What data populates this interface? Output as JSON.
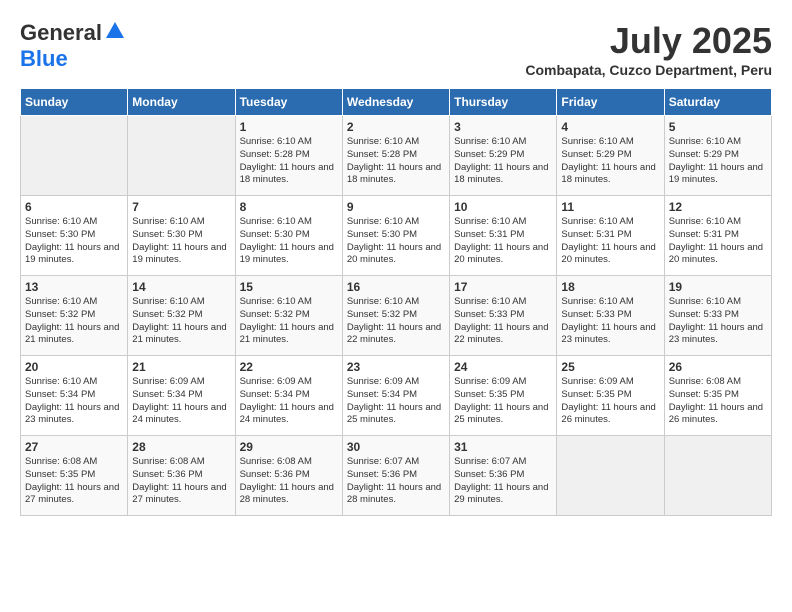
{
  "header": {
    "logo_general": "General",
    "logo_blue": "Blue",
    "month_year": "July 2025",
    "location": "Combapata, Cuzco Department, Peru"
  },
  "days_of_week": [
    "Sunday",
    "Monday",
    "Tuesday",
    "Wednesday",
    "Thursday",
    "Friday",
    "Saturday"
  ],
  "weeks": [
    [
      {
        "day": "",
        "info": ""
      },
      {
        "day": "",
        "info": ""
      },
      {
        "day": "1",
        "info": "Sunrise: 6:10 AM\nSunset: 5:28 PM\nDaylight: 11 hours and 18 minutes."
      },
      {
        "day": "2",
        "info": "Sunrise: 6:10 AM\nSunset: 5:28 PM\nDaylight: 11 hours and 18 minutes."
      },
      {
        "day": "3",
        "info": "Sunrise: 6:10 AM\nSunset: 5:29 PM\nDaylight: 11 hours and 18 minutes."
      },
      {
        "day": "4",
        "info": "Sunrise: 6:10 AM\nSunset: 5:29 PM\nDaylight: 11 hours and 18 minutes."
      },
      {
        "day": "5",
        "info": "Sunrise: 6:10 AM\nSunset: 5:29 PM\nDaylight: 11 hours and 19 minutes."
      }
    ],
    [
      {
        "day": "6",
        "info": "Sunrise: 6:10 AM\nSunset: 5:30 PM\nDaylight: 11 hours and 19 minutes."
      },
      {
        "day": "7",
        "info": "Sunrise: 6:10 AM\nSunset: 5:30 PM\nDaylight: 11 hours and 19 minutes."
      },
      {
        "day": "8",
        "info": "Sunrise: 6:10 AM\nSunset: 5:30 PM\nDaylight: 11 hours and 19 minutes."
      },
      {
        "day": "9",
        "info": "Sunrise: 6:10 AM\nSunset: 5:30 PM\nDaylight: 11 hours and 20 minutes."
      },
      {
        "day": "10",
        "info": "Sunrise: 6:10 AM\nSunset: 5:31 PM\nDaylight: 11 hours and 20 minutes."
      },
      {
        "day": "11",
        "info": "Sunrise: 6:10 AM\nSunset: 5:31 PM\nDaylight: 11 hours and 20 minutes."
      },
      {
        "day": "12",
        "info": "Sunrise: 6:10 AM\nSunset: 5:31 PM\nDaylight: 11 hours and 20 minutes."
      }
    ],
    [
      {
        "day": "13",
        "info": "Sunrise: 6:10 AM\nSunset: 5:32 PM\nDaylight: 11 hours and 21 minutes."
      },
      {
        "day": "14",
        "info": "Sunrise: 6:10 AM\nSunset: 5:32 PM\nDaylight: 11 hours and 21 minutes."
      },
      {
        "day": "15",
        "info": "Sunrise: 6:10 AM\nSunset: 5:32 PM\nDaylight: 11 hours and 21 minutes."
      },
      {
        "day": "16",
        "info": "Sunrise: 6:10 AM\nSunset: 5:32 PM\nDaylight: 11 hours and 22 minutes."
      },
      {
        "day": "17",
        "info": "Sunrise: 6:10 AM\nSunset: 5:33 PM\nDaylight: 11 hours and 22 minutes."
      },
      {
        "day": "18",
        "info": "Sunrise: 6:10 AM\nSunset: 5:33 PM\nDaylight: 11 hours and 23 minutes."
      },
      {
        "day": "19",
        "info": "Sunrise: 6:10 AM\nSunset: 5:33 PM\nDaylight: 11 hours and 23 minutes."
      }
    ],
    [
      {
        "day": "20",
        "info": "Sunrise: 6:10 AM\nSunset: 5:34 PM\nDaylight: 11 hours and 23 minutes."
      },
      {
        "day": "21",
        "info": "Sunrise: 6:09 AM\nSunset: 5:34 PM\nDaylight: 11 hours and 24 minutes."
      },
      {
        "day": "22",
        "info": "Sunrise: 6:09 AM\nSunset: 5:34 PM\nDaylight: 11 hours and 24 minutes."
      },
      {
        "day": "23",
        "info": "Sunrise: 6:09 AM\nSunset: 5:34 PM\nDaylight: 11 hours and 25 minutes."
      },
      {
        "day": "24",
        "info": "Sunrise: 6:09 AM\nSunset: 5:35 PM\nDaylight: 11 hours and 25 minutes."
      },
      {
        "day": "25",
        "info": "Sunrise: 6:09 AM\nSunset: 5:35 PM\nDaylight: 11 hours and 26 minutes."
      },
      {
        "day": "26",
        "info": "Sunrise: 6:08 AM\nSunset: 5:35 PM\nDaylight: 11 hours and 26 minutes."
      }
    ],
    [
      {
        "day": "27",
        "info": "Sunrise: 6:08 AM\nSunset: 5:35 PM\nDaylight: 11 hours and 27 minutes."
      },
      {
        "day": "28",
        "info": "Sunrise: 6:08 AM\nSunset: 5:36 PM\nDaylight: 11 hours and 27 minutes."
      },
      {
        "day": "29",
        "info": "Sunrise: 6:08 AM\nSunset: 5:36 PM\nDaylight: 11 hours and 28 minutes."
      },
      {
        "day": "30",
        "info": "Sunrise: 6:07 AM\nSunset: 5:36 PM\nDaylight: 11 hours and 28 minutes."
      },
      {
        "day": "31",
        "info": "Sunrise: 6:07 AM\nSunset: 5:36 PM\nDaylight: 11 hours and 29 minutes."
      },
      {
        "day": "",
        "info": ""
      },
      {
        "day": "",
        "info": ""
      }
    ]
  ]
}
